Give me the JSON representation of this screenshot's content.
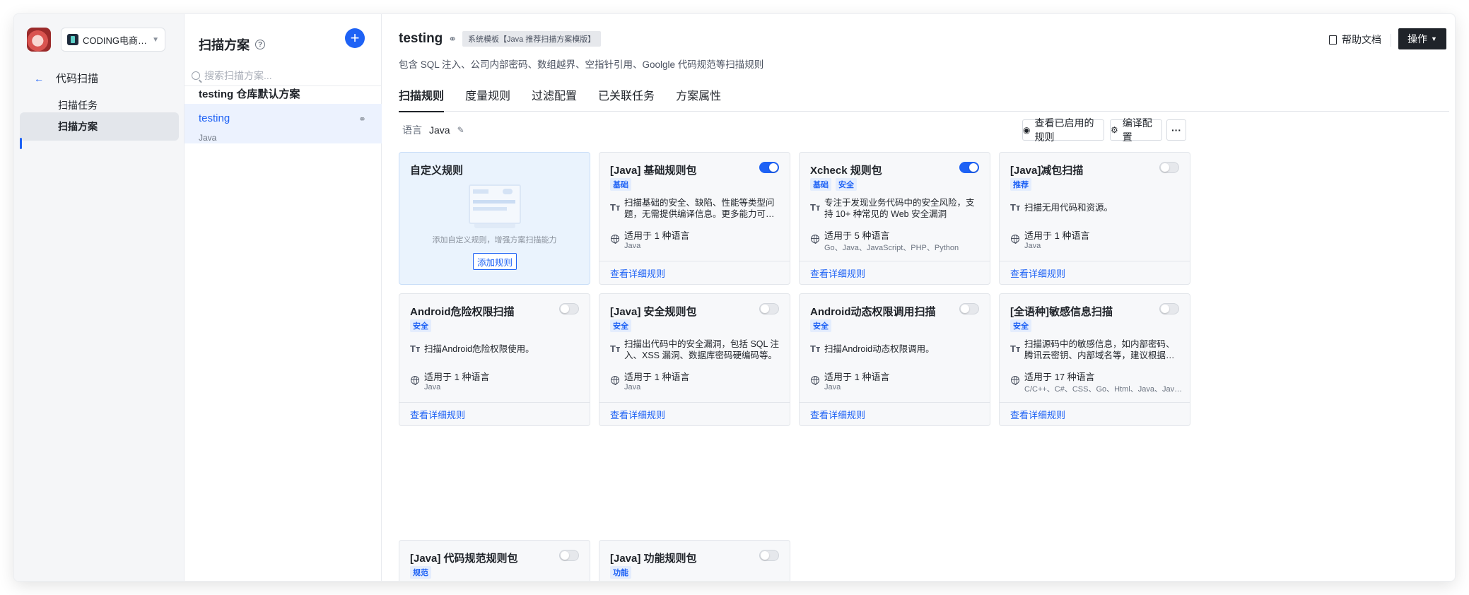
{
  "nav": {
    "team_name": "CODING电商平...",
    "back_label": "代码扫描",
    "items": [
      {
        "label": "扫描任务"
      },
      {
        "label": "扫描方案"
      }
    ]
  },
  "list": {
    "title": "扫描方案",
    "search_placeholder": "搜索扫描方案...",
    "schemes": [
      {
        "name": "testing 仓库默认方案",
        "lang": ""
      },
      {
        "name": "testing",
        "lang": "Java"
      }
    ]
  },
  "main": {
    "title": "testing",
    "template_tag": "系统模板【Java 推荐扫描方案模版】",
    "subtitle": "包含 SQL 注入、公司内部密码、数组越界、空指针引用、Goolgle 代码规范等扫描规则",
    "help_doc": "帮助文档",
    "operate": "操作",
    "tabs": [
      "扫描规则",
      "度量规则",
      "过滤配置",
      "已关联任务",
      "方案属性"
    ],
    "lang_label": "语言",
    "lang_value": "Java",
    "view_enabled": "查看已启用的规则",
    "compile_config": "编译配置",
    "more": "···"
  },
  "custom_card": {
    "title": "自定义规则",
    "hint": "添加自定义规则，增强方案扫描能力",
    "button": "添加规则"
  },
  "cards": [
    {
      "title": "[Java] 基础规则包",
      "tags": [
        "基础"
      ],
      "enabled": true,
      "desc": "扫描基础的安全、缺陷、性能等类型问题，无需提供编译信息。更多能力可开启 Java 功能规则包",
      "applies": "适用于 1 种语言",
      "langs": "Java",
      "link": "查看详细规则"
    },
    {
      "title": "Xcheck 规则包",
      "tags": [
        "基础",
        "安全"
      ],
      "enabled": true,
      "desc": "专注于发现业务代码中的安全风险，支持 10+ 种常见的 Web 安全漏洞",
      "applies": "适用于 5 种语言",
      "langs": "Go、Java、JavaScript、PHP、Python",
      "link": "查看详细规则"
    },
    {
      "title": "[Java]减包扫描",
      "tags": [
        "推荐"
      ],
      "enabled": false,
      "desc": "扫描无用代码和资源。",
      "applies": "适用于 1 种语言",
      "langs": "Java",
      "link": "查看详细规则"
    },
    {
      "title": "Android危险权限扫描",
      "tags": [
        "安全"
      ],
      "enabled": false,
      "desc": "扫描Android危险权限使用。",
      "applies": "适用于 1 种语言",
      "langs": "Java",
      "link": "查看详细规则"
    },
    {
      "title": "[Java] 安全规则包",
      "tags": [
        "安全"
      ],
      "enabled": false,
      "desc": "扫描出代码中的安全漏洞，包括 SQL 注入、XSS 漏洞、数据库密码硬编码等。",
      "applies": "适用于 1 种语言",
      "langs": "Java",
      "link": "查看详细规则"
    },
    {
      "title": "Android动态权限调用扫描",
      "tags": [
        "安全"
      ],
      "enabled": false,
      "desc": "扫描Android动态权限调用。",
      "applies": "适用于 1 种语言",
      "langs": "Java",
      "link": "查看详细规则"
    },
    {
      "title": "[全语种]敏感信息扫描",
      "tags": [
        "安全"
      ],
      "enabled": false,
      "desc": "扫描源码中的敏感信息，如内部密码、腾讯云密钥、内部域名等，建议根据团队实际情况配置",
      "applies": "适用于 17 种语言",
      "langs": "C/C++、C#、CSS、Go、Html、Java、JavaScript、Kotlin",
      "link": "查看详细规则"
    },
    {
      "title": "[Java] 代码规范规则包",
      "tags": [
        "规范"
      ],
      "enabled": false
    },
    {
      "title": "[Java] 功能规则包",
      "tags": [
        "功能"
      ],
      "enabled": false
    }
  ]
}
